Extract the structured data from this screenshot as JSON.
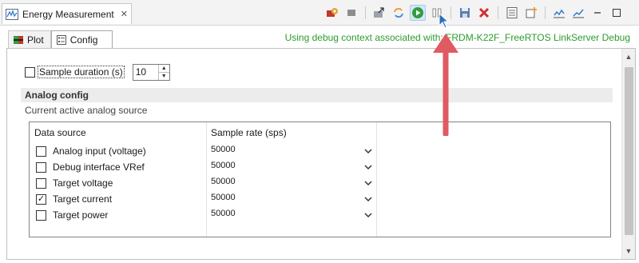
{
  "view": {
    "tab_label": "Energy Measurement",
    "close_glyph": "✕"
  },
  "toolbar": {
    "buttons": [
      {
        "icon": "configure-icon"
      },
      {
        "icon": "stop-icon"
      },
      {
        "icon": "export-icon"
      },
      {
        "icon": "refresh-icon"
      },
      {
        "icon": "run-icon",
        "active": true
      },
      {
        "icon": "pause-icon"
      },
      {
        "icon": "save-icon"
      },
      {
        "icon": "delete-icon"
      },
      {
        "icon": "layout-icon"
      },
      {
        "icon": "new-icon"
      },
      {
        "icon": "chart-icon"
      },
      {
        "icon": "chart-line-icon"
      },
      {
        "icon": "minimize-icon"
      },
      {
        "icon": "maximize-icon"
      }
    ]
  },
  "subtabs": {
    "plot": "Plot",
    "config": "Config"
  },
  "debug_context": "Using debug context associated with: FRDM-K22F_FreeRTOS LinkServer Debug",
  "config": {
    "sample_duration_label": "Sample duration (s)",
    "sample_duration_checked": false,
    "sample_duration_value": "10",
    "section_title": "Analog config",
    "section_desc": "Current active analog source",
    "table": {
      "headers": [
        "Data source",
        "Sample rate (sps)"
      ],
      "rows": [
        {
          "source": "Analog input (voltage)",
          "rate": "50000",
          "checked": false
        },
        {
          "source": "Debug interface VRef",
          "rate": "50000",
          "checked": false
        },
        {
          "source": "Target voltage",
          "rate": "50000",
          "checked": false
        },
        {
          "source": "Target current",
          "rate": "50000",
          "checked": true
        },
        {
          "source": "Target power",
          "rate": "50000",
          "checked": false
        }
      ]
    }
  },
  "colors": {
    "debug_text": "#2c9c2c",
    "annotation_arrow": "#e05a62",
    "section_bg": "#ececec"
  }
}
